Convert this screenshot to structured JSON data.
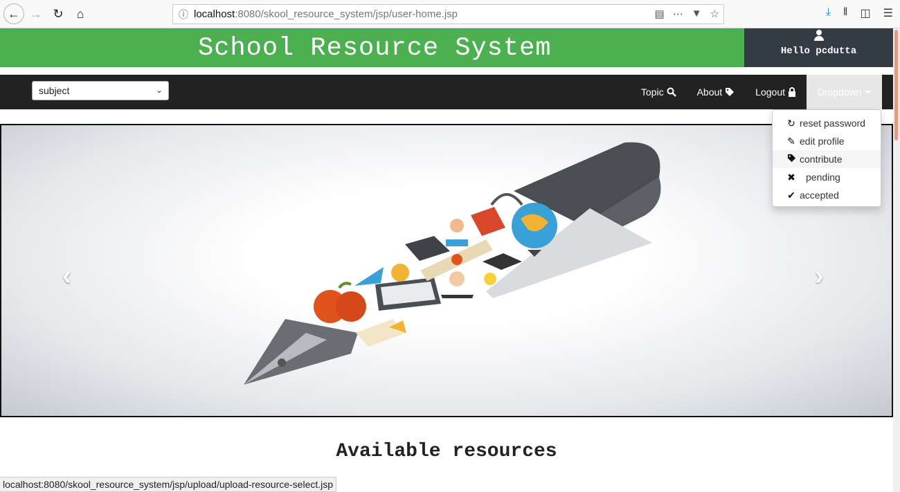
{
  "browser": {
    "url_host": "localhost",
    "url_rest": ":8080/skool_resource_system/jsp/user-home.jsp"
  },
  "header": {
    "title": "School Resource System",
    "greeting": "Hello pcdutta"
  },
  "navbar": {
    "select_value": "subject",
    "topic_label": "Topic",
    "about_label": "About",
    "logout_label": "Logout",
    "dropdown_label": "Dropdown"
  },
  "dropdown_menu": {
    "items": [
      {
        "label": "reset password",
        "icon": "refresh-icon"
      },
      {
        "label": "edit profile",
        "icon": "pencil-icon"
      },
      {
        "label": "contribute",
        "icon": "tag-icon"
      },
      {
        "label": "pending",
        "icon": "x-icon"
      },
      {
        "label": "accepted",
        "icon": "check-icon"
      }
    ]
  },
  "main": {
    "section_title": "Available resources"
  },
  "status_bar": {
    "url": "localhost:8080/skool_resource_system/jsp/upload/upload-resource-select.jsp"
  },
  "colors": {
    "header_green": "#4caf50",
    "user_box": "#333c45",
    "navbar": "#222222"
  }
}
